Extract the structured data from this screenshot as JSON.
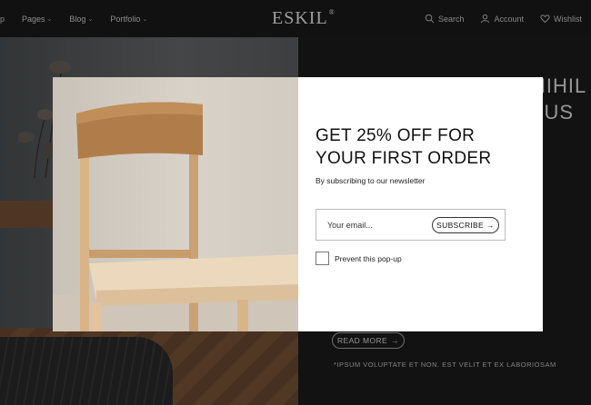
{
  "header": {
    "nav_left": [
      {
        "label": "op"
      },
      {
        "label": "Pages"
      },
      {
        "label": "Blog"
      },
      {
        "label": "Portfolio"
      }
    ],
    "logo": "ESKIL",
    "logo_mark": "®",
    "nav_right": [
      {
        "label": "Search",
        "icon": "search-icon"
      },
      {
        "label": "Account",
        "icon": "user-icon"
      },
      {
        "label": "Wishlist",
        "icon": "heart-icon"
      }
    ]
  },
  "hero": {
    "title_line1": "NIHIL",
    "title_line2": "TUS",
    "read_more": "READ MORE",
    "description": "*IPSUM VOLUPTATE ET NON. EST VELIT ET EX LABORIOSAM"
  },
  "popup": {
    "title_line1": "GET 25% OFF FOR",
    "title_line2": "YOUR FIRST ORDER",
    "subtitle": "By subscribing to our newsletter",
    "email_placeholder": "Your email...",
    "subscribe_label": "SUBSCRIBE",
    "prevent_label": "Prevent this pop-up",
    "close_icon": "close-icon"
  },
  "colors": {
    "header_bg": "#1b1b1b",
    "modal_bg": "#ffffff",
    "text_dark": "#111111"
  }
}
